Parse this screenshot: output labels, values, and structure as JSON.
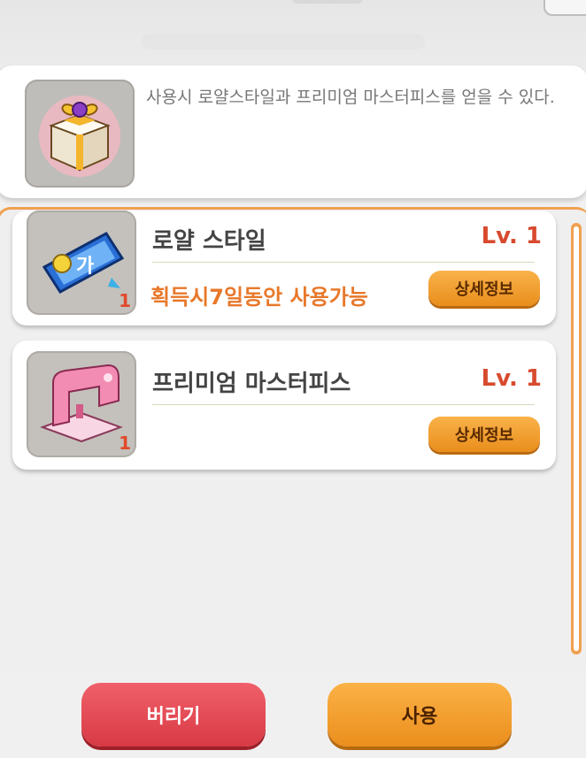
{
  "description": {
    "icon": "gift-box-icon",
    "text": "사용시 로얄스타일과 프리미엄 마스터피스를 얻을 수 있다."
  },
  "items": [
    {
      "icon": "royal-style-coupon-icon",
      "quantity": "1",
      "name": "로얄 스타일",
      "level": "Lv. 1",
      "note": "획득시7일동안 사용가능",
      "detail_label": "상세정보"
    },
    {
      "icon": "sewing-machine-icon",
      "quantity": "1",
      "name": "프리미엄 마스터피스",
      "level": "Lv. 1",
      "note": "",
      "detail_label": "상세정보"
    }
  ],
  "buttons": {
    "discard_label": "버리기",
    "use_label": "사용"
  },
  "colors": {
    "accent": "#f0a050",
    "discard": "#d83a44",
    "use": "#eb8e1d",
    "level": "#d84a2e"
  }
}
